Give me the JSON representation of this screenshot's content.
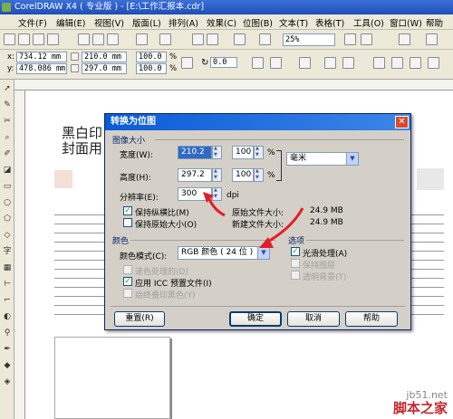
{
  "app": {
    "title": "CorelDRAW X4 ( 专业版 ) - [E:\\工作汇报本.cdr]"
  },
  "menu": [
    "文件(F)",
    "编辑(E)",
    "视图(V)",
    "版面(L)",
    "排列(A)",
    "效果(C)",
    "位图(B)",
    "文本(T)",
    "表格(T)",
    "工具(O)",
    "窗口(W)",
    "帮助"
  ],
  "toolbar": {
    "zoom": "25%"
  },
  "props": {
    "x_label": "x:",
    "x": "734.12 mm",
    "y_label": "y:",
    "y": "478.086 mm",
    "w": "210.0 mm",
    "h": "297.0 mm",
    "scale_x": "100.0",
    "scale_y": "100.0",
    "pct": "%",
    "rotation": "0.0"
  },
  "document": {
    "line1": "黑白印",
    "line2": "封面用"
  },
  "dialog": {
    "title": "转换为位图",
    "size_group": "图像大小",
    "width_label": "宽度(W):",
    "width": "210.2",
    "width_pct": "100",
    "pct": "%",
    "height_label": "高度(H):",
    "height": "297.2",
    "height_pct": "100",
    "unit": "毫米",
    "res_label": "分辨率(E):",
    "res": "300",
    "res_unit": "dpi",
    "keep_ratio": "保持纵横比(M)",
    "keep_size": "保持原始大小(O)",
    "orig_label": "原始文件大小:",
    "orig": "24.9 MB",
    "new_label": "新建文件大小:",
    "new": "24.9 MB",
    "color_group": "颜色",
    "mode_label": "颜色模式(C):",
    "mode": "RGB 颜色 ( 24 位 )",
    "dither": "递色处理的(D)",
    "icc": "应用 ICC 预置文件(I)",
    "overprint": "始终叠印黑色(Y)",
    "options_group": "选项",
    "smooth": "光滑处理(A)",
    "transparent_bg": "保持图层",
    "transparent": "透明背景(T)",
    "reset": "重置(R)",
    "ok": "确定",
    "cancel": "取消",
    "help": "帮助"
  },
  "watermark": {
    "site": "jb51.net",
    "name": "脚本之家"
  }
}
